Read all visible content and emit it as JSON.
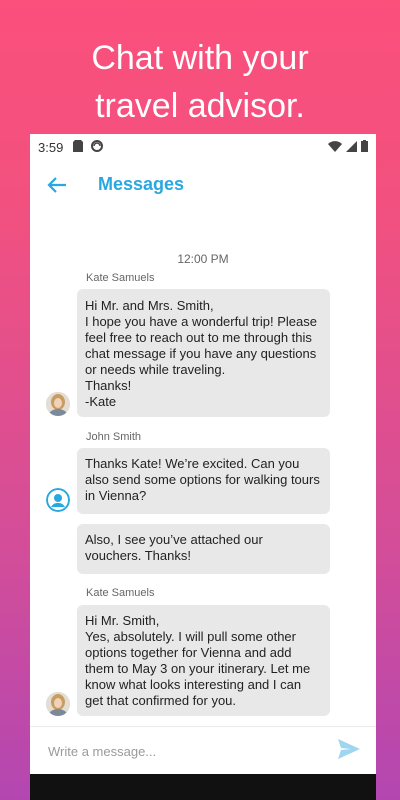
{
  "headline": {
    "line1": "Chat with your",
    "line2": "travel advisor."
  },
  "status": {
    "time": "3:59"
  },
  "appbar": {
    "title": "Messages",
    "back_icon": "arrow-left-icon"
  },
  "chat": {
    "timestamp": "12:00 PM",
    "messages": [
      {
        "sender": "Kate Samuels",
        "text": "Hi Mr. and Mrs. Smith,\nI hope you have a wonderful trip! Please feel free to reach out to me through this chat message if you have any questions or needs while traveling.\nThanks!\n-Kate"
      },
      {
        "sender": "John Smith",
        "text": "Thanks Kate! We’re excited. Can you also send some options for walking tours in Vienna?"
      },
      {
        "sender": "",
        "text": "Also, I see you’ve attached our vouchers. Thanks!"
      },
      {
        "sender": "Kate Samuels",
        "text": "Hi Mr. Smith,\nYes, absolutely. I will pull some other options together for Vienna and add them to May 3 on your itinerary. Let me know what looks interesting and I can get that confirmed for you."
      }
    ]
  },
  "composer": {
    "placeholder": "Write a message..."
  },
  "colors": {
    "accent": "#28a8e0",
    "bubble": "#e8e8e8",
    "gradient_top": "#fb4f7c",
    "gradient_bottom": "#b347b1"
  }
}
